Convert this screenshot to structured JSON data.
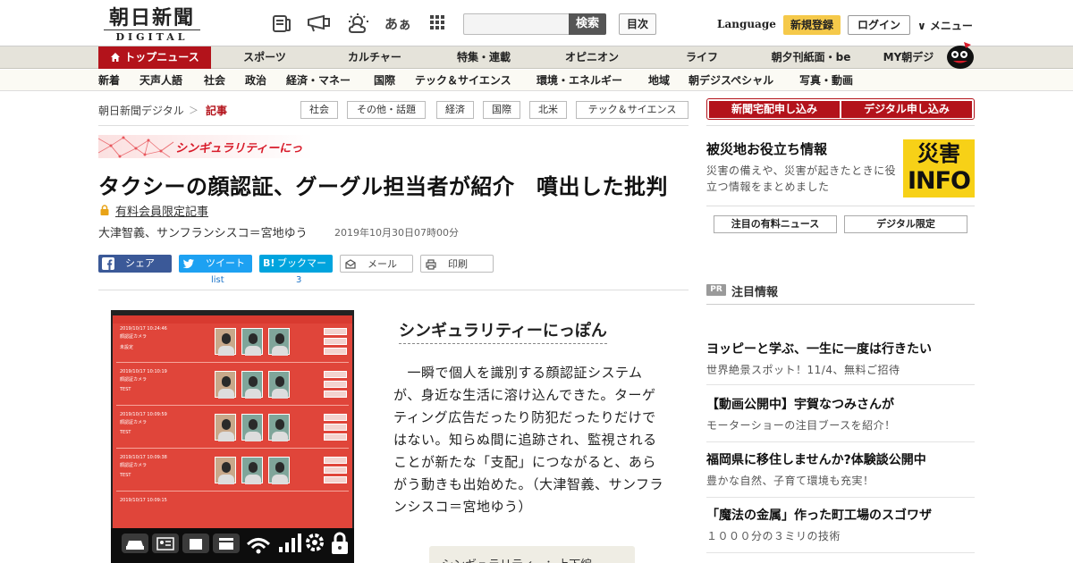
{
  "header": {
    "logo_main": "朝日新聞",
    "logo_sub": "DIGITAL",
    "icons": [
      "newspaper-icon",
      "megaphone-icon",
      "weather-icon",
      "font-size-icon",
      "grid-apps-icon"
    ],
    "font_size_label": "あぁ",
    "search_placeholder": "",
    "search_button": "検索",
    "toc_button": "目次",
    "language": "Language",
    "register_button": "新規登録",
    "login_button": "ログイン",
    "menu_button": "∨ メニュー"
  },
  "main_nav": [
    {
      "label": "トップニュース",
      "active": true
    },
    {
      "label": "スポーツ"
    },
    {
      "label": "カルチャー"
    },
    {
      "label": "特集・連載"
    },
    {
      "label": "オピニオン"
    },
    {
      "label": "ライフ"
    },
    {
      "label": "朝夕刊紙面・be"
    },
    {
      "label": "MY朝デジ"
    }
  ],
  "sub_nav": [
    "新着",
    "天声人語",
    "社会",
    "政治",
    "経済・マネー",
    "国際",
    "テック＆サイエンス",
    "環境・エネルギー",
    "地域",
    "朝デジスペシャル",
    "写真・動画"
  ],
  "breadcrumb": {
    "home": "朝日新聞デジタル",
    "sep": "＞",
    "current": "記事"
  },
  "tags": [
    "社会",
    "その他・話題",
    "経済",
    "国際",
    "北米",
    "テック＆サイエンス"
  ],
  "article": {
    "series_banner": "シンギュラリティーにっぽん",
    "title": "タクシーの顔認証、グーグル担当者が紹介　噴出した批判",
    "member_only": "有料会員限定記事",
    "byline": "大津智義、サンフランシスコ＝宮地ゆう",
    "date": "2019年10月30日07時00分",
    "share": {
      "facebook": "シェア",
      "twitter": "ツイート",
      "twitter_count": "list",
      "hatena": "ブックマーク",
      "hatena_count": "3",
      "mail": "メール",
      "print": "印刷"
    },
    "section_heading": "シンギュラリティーにっぽん",
    "lead": "　一瞬で個人を識別する顔認証システムが、身近な生活に溶け込んできた。ターゲティング広告だったり防犯だったりだけではない。知らぬ間に追跡され、監視されることが新たな「支配」につながると、あらがう動きも出始めた。（大津智義、サンフランシスコ＝宮地ゆう）",
    "related_box": "シンギュラリティー：上下編"
  },
  "photo": {
    "rows": [
      {
        "timestamp": "2019/10/17 10:24:46",
        "status": "未設定"
      },
      {
        "timestamp": "2019/10/17 10:10:19",
        "status": "TEST"
      },
      {
        "timestamp": "2019/10/17 10:09:59",
        "status": "TEST"
      },
      {
        "timestamp": "2019/10/17 10:09:38",
        "status": "TEST"
      },
      {
        "timestamp": "2019/10/17 10:09:15",
        "status": ""
      }
    ],
    "camera_label": "顔認証カメラ"
  },
  "sidebar": {
    "order_buttons": [
      "新聞宅配申し込み",
      "デジタル申し込み"
    ],
    "disaster_title": "被災地お役立ち情報",
    "disaster_desc": "災害の備えや、災害が起きたときに役立つ情報をまとめました",
    "info_badge_top": "災害",
    "info_badge_bottom": "INFO",
    "pick_buttons": [
      "注目の有料ニュース",
      "デジタル限定"
    ],
    "pr_badge": "PR",
    "pr_heading": "注目情報",
    "pr_items": [
      {
        "title": "ヨッピーと学ぶ、一生に一度は行きたい",
        "sub": "世界絶景スポット！11/4、無料ご招待"
      },
      {
        "title": "【動画公開中】宇賀なつみさんが",
        "sub": "モーターショーの注目ブースを紹介！"
      },
      {
        "title": "福岡県に移住しませんか?体験談公開中",
        "sub": "豊かな自然、子育て環境も充実！"
      },
      {
        "title": "「魔法の金属」作った町工場のスゴワザ",
        "sub": "１０００分の３ミリの技術"
      }
    ]
  },
  "colors": {
    "brand_red": "#b3131b",
    "register_yellow": "#f5c94a",
    "facebook": "#3b5998",
    "twitter": "#1da1f2",
    "hatena": "#00a4de",
    "info_yellow": "#f7d117"
  }
}
